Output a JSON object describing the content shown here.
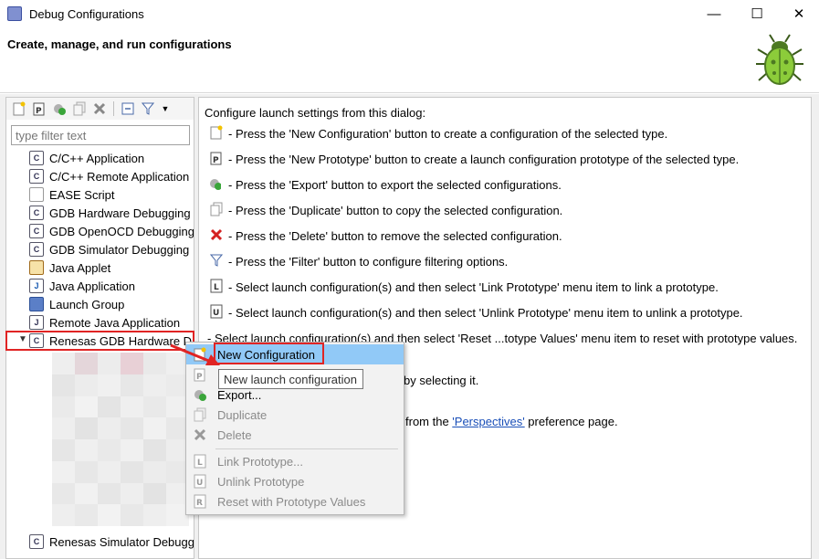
{
  "window": {
    "title": "Debug Configurations",
    "minimize_glyph": "—",
    "maximize_glyph": "☐",
    "close_glyph": "✕"
  },
  "header": {
    "heading": "Create, manage, and run configurations"
  },
  "left_pane": {
    "filter_placeholder": "type filter text",
    "tree": [
      {
        "label": "C/C++ Application",
        "icon": "c-app-icon"
      },
      {
        "label": "C/C++ Remote Application",
        "icon": "c-remote-icon"
      },
      {
        "label": "EASE Script",
        "icon": "script-icon"
      },
      {
        "label": "GDB Hardware Debugging",
        "icon": "c-hw-icon"
      },
      {
        "label": "GDB OpenOCD Debugging",
        "icon": "c-openocd-icon"
      },
      {
        "label": "GDB Simulator Debugging",
        "icon": "c-sim-icon"
      },
      {
        "label": "Java Applet",
        "icon": "applet-icon"
      },
      {
        "label": "Java Application",
        "icon": "java-app-icon"
      },
      {
        "label": "Launch Group",
        "icon": "launch-group-icon"
      },
      {
        "label": "Remote Java Application",
        "icon": "remote-java-icon"
      },
      {
        "label": "Renesas GDB Hardware D",
        "icon": "c-renesas-icon"
      },
      {
        "label": "Renesas Simulator Debugg",
        "icon": "c-renesas-sim-icon"
      }
    ]
  },
  "right_pane": {
    "intro": "Configure launch settings from this dialog:",
    "lines": [
      "- Press the 'New Configuration' button to create a configuration of the selected type.",
      "- Press the 'New Prototype' button to create a launch configuration prototype of the selected type.",
      "- Press the 'Export' button to export the selected configurations.",
      "- Press the 'Duplicate' button to copy the selected configuration.",
      "- Press the 'Delete' button to remove the selected configuration.",
      "- Press the 'Filter' button to configure filtering options.",
      "- Select launch configuration(s) and then select 'Link Prototype' menu item to link a prototype.",
      "- Select launch configuration(s) and then select 'Unlink Prototype' menu item to unlink a prototype.",
      "- Select launch configuration(s) and then select 'Reset ...totype Values' menu item to reset with prototype values."
    ],
    "partial_line_1": "by selecting it.",
    "partial_line_2_pre": "from the ",
    "partial_line_2_link": "'Perspectives'",
    "partial_line_2_post": " preference page."
  },
  "context_menu": {
    "items": [
      {
        "label": "New Configuration",
        "enabled": true,
        "highlighted": true
      },
      {
        "label": "Export...",
        "enabled": true
      },
      {
        "label": "Duplicate",
        "enabled": false
      },
      {
        "label": "Delete",
        "enabled": false
      },
      {
        "label": "Link Prototype...",
        "enabled": false
      },
      {
        "label": "Unlink Prototype",
        "enabled": false
      },
      {
        "label": "Reset with Prototype Values",
        "enabled": false
      }
    ]
  },
  "tooltip": {
    "text": "New launch configuration"
  },
  "colors": {
    "highlight": "#91c9f7",
    "annotation_red": "#e02424",
    "link": "#1a4fb8"
  }
}
